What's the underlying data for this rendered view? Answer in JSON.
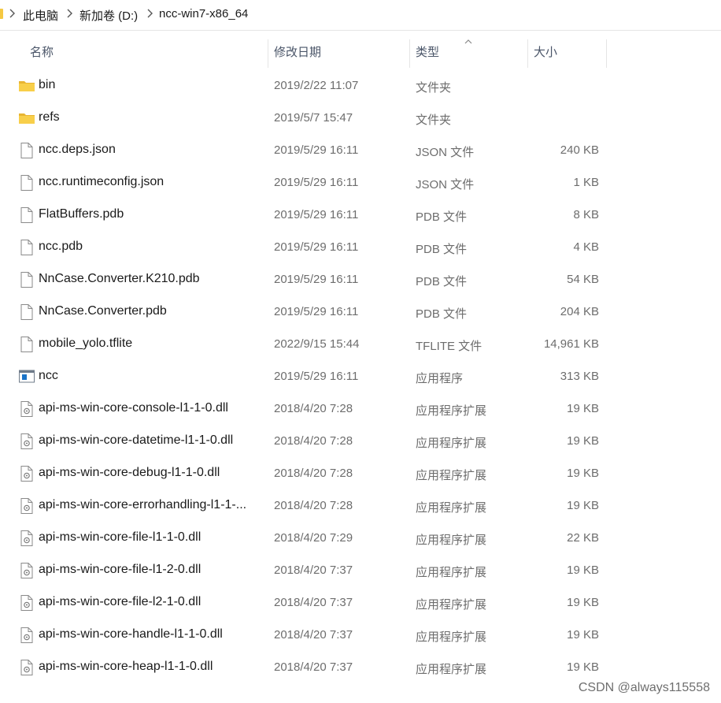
{
  "breadcrumb": {
    "items": [
      "此电脑",
      "新加卷 (D:)",
      "ncc-win7-x86_64"
    ]
  },
  "columns": {
    "name": "名称",
    "date": "修改日期",
    "type": "类型",
    "size": "大小"
  },
  "files": [
    {
      "name": "bin",
      "date": "2019/2/22 11:07",
      "type": "文件夹",
      "size": "",
      "icon": "folder-icon"
    },
    {
      "name": "refs",
      "date": "2019/5/7 15:47",
      "type": "文件夹",
      "size": "",
      "icon": "folder-icon"
    },
    {
      "name": "ncc.deps.json",
      "date": "2019/5/29 16:11",
      "type": "JSON 文件",
      "size": "240 KB",
      "icon": "file-icon"
    },
    {
      "name": "ncc.runtimeconfig.json",
      "date": "2019/5/29 16:11",
      "type": "JSON 文件",
      "size": "1 KB",
      "icon": "file-icon"
    },
    {
      "name": "FlatBuffers.pdb",
      "date": "2019/5/29 16:11",
      "type": "PDB 文件",
      "size": "8 KB",
      "icon": "file-icon"
    },
    {
      "name": "ncc.pdb",
      "date": "2019/5/29 16:11",
      "type": "PDB 文件",
      "size": "4 KB",
      "icon": "file-icon"
    },
    {
      "name": "NnCase.Converter.K210.pdb",
      "date": "2019/5/29 16:11",
      "type": "PDB 文件",
      "size": "54 KB",
      "icon": "file-icon"
    },
    {
      "name": "NnCase.Converter.pdb",
      "date": "2019/5/29 16:11",
      "type": "PDB 文件",
      "size": "204 KB",
      "icon": "file-icon"
    },
    {
      "name": "mobile_yolo.tflite",
      "date": "2022/9/15 15:44",
      "type": "TFLITE 文件",
      "size": "14,961 KB",
      "icon": "file-icon"
    },
    {
      "name": "ncc",
      "date": "2019/5/29 16:11",
      "type": "应用程序",
      "size": "313 KB",
      "icon": "application-icon"
    },
    {
      "name": "api-ms-win-core-console-l1-1-0.dll",
      "date": "2018/4/20 7:28",
      "type": "应用程序扩展",
      "size": "19 KB",
      "icon": "dll-file-icon"
    },
    {
      "name": "api-ms-win-core-datetime-l1-1-0.dll",
      "date": "2018/4/20 7:28",
      "type": "应用程序扩展",
      "size": "19 KB",
      "icon": "dll-file-icon"
    },
    {
      "name": "api-ms-win-core-debug-l1-1-0.dll",
      "date": "2018/4/20 7:28",
      "type": "应用程序扩展",
      "size": "19 KB",
      "icon": "dll-file-icon"
    },
    {
      "name": "api-ms-win-core-errorhandling-l1-1-...",
      "date": "2018/4/20 7:28",
      "type": "应用程序扩展",
      "size": "19 KB",
      "icon": "dll-file-icon"
    },
    {
      "name": "api-ms-win-core-file-l1-1-0.dll",
      "date": "2018/4/20 7:29",
      "type": "应用程序扩展",
      "size": "22 KB",
      "icon": "dll-file-icon"
    },
    {
      "name": "api-ms-win-core-file-l1-2-0.dll",
      "date": "2018/4/20 7:37",
      "type": "应用程序扩展",
      "size": "19 KB",
      "icon": "dll-file-icon"
    },
    {
      "name": "api-ms-win-core-file-l2-1-0.dll",
      "date": "2018/4/20 7:37",
      "type": "应用程序扩展",
      "size": "19 KB",
      "icon": "dll-file-icon"
    },
    {
      "name": "api-ms-win-core-handle-l1-1-0.dll",
      "date": "2018/4/20 7:37",
      "type": "应用程序扩展",
      "size": "19 KB",
      "icon": "dll-file-icon"
    },
    {
      "name": "api-ms-win-core-heap-l1-1-0.dll",
      "date": "2018/4/20 7:37",
      "type": "应用程序扩展",
      "size": "19 KB",
      "icon": "dll-file-icon"
    }
  ],
  "watermark": "CSDN @always115558",
  "colors": {
    "folder": "#f5c842",
    "accent": "#0078d7",
    "header_text": "#4a5568",
    "detail_text": "#6d6d6d"
  }
}
